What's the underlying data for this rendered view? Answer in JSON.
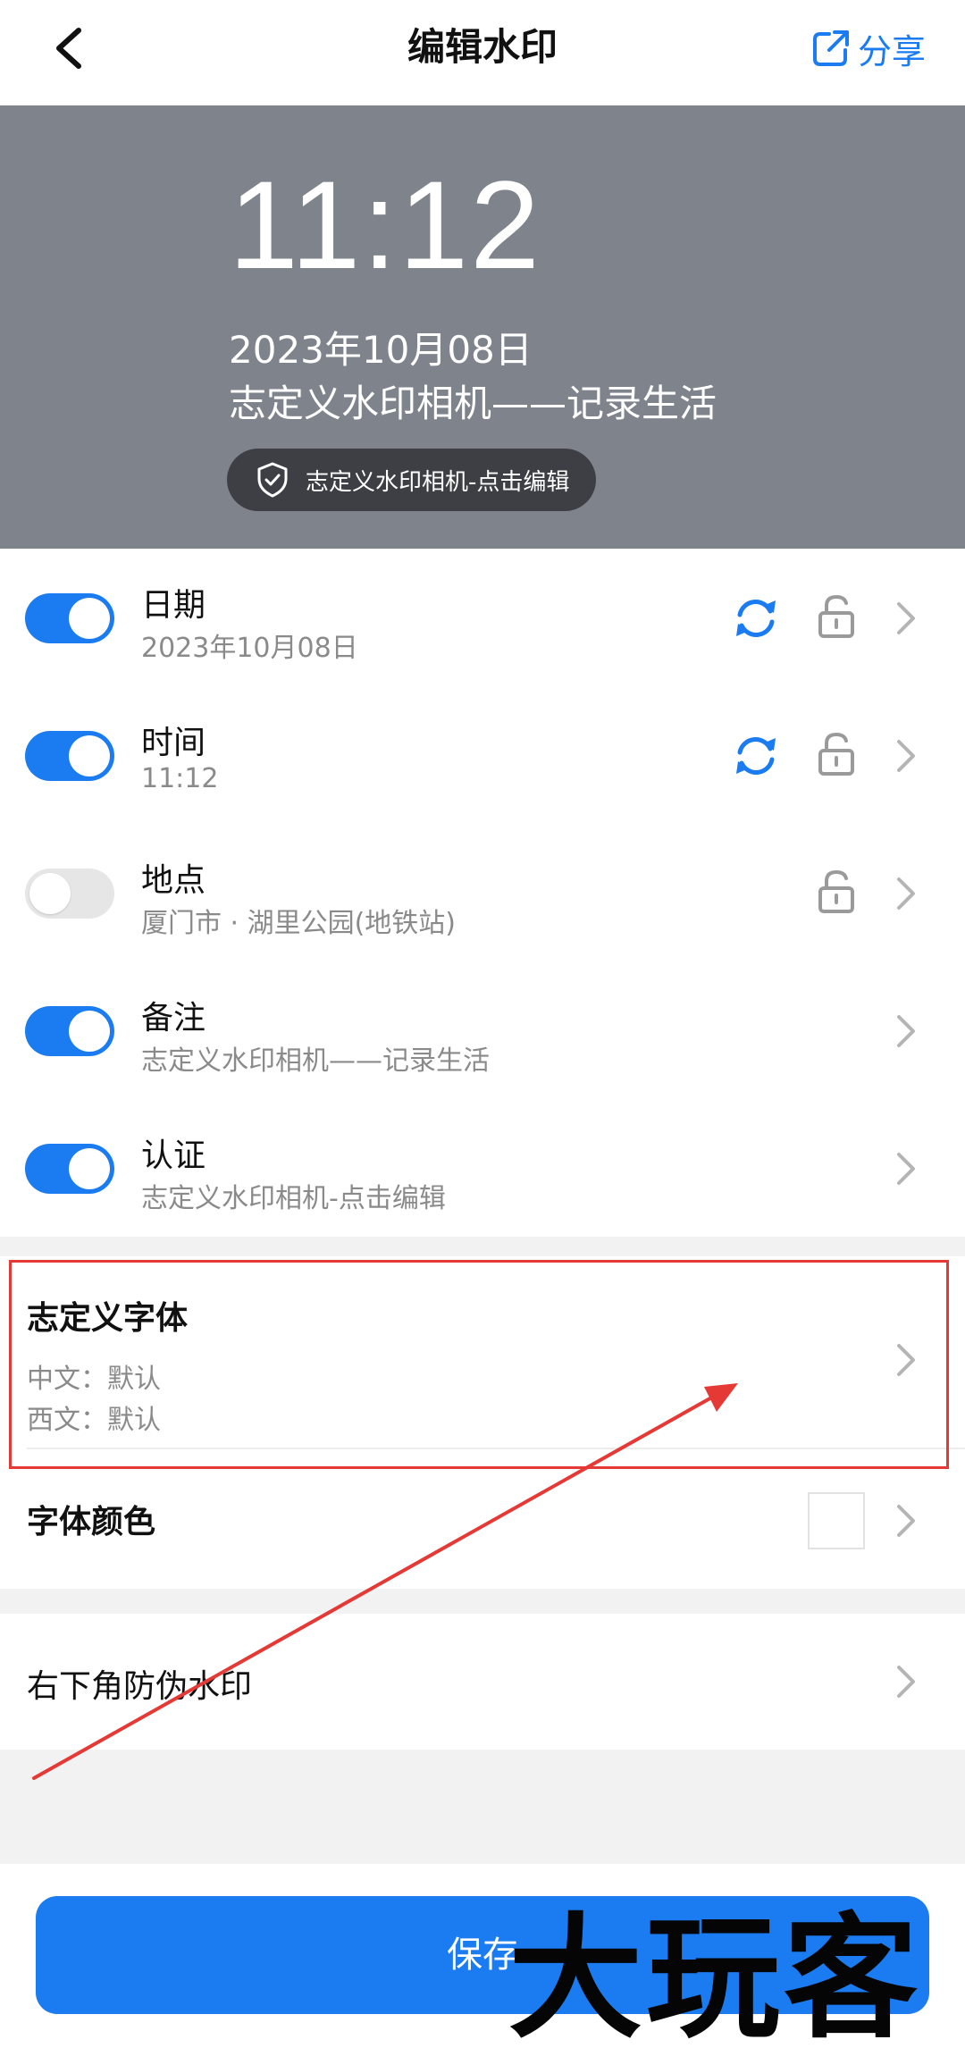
{
  "header": {
    "title": "编辑水印",
    "share_label": "分享"
  },
  "preview": {
    "time": "11:12",
    "date": "2023年10月08日",
    "note": "志定义水印相机——记录生活",
    "badge": "志定义水印相机-点击编辑"
  },
  "items": [
    {
      "label": "日期",
      "value": "2023年10月08日",
      "enabled": true
    },
    {
      "label": "时间",
      "value": "11:12",
      "enabled": true
    },
    {
      "label": "地点",
      "value": "厦门市 · 湖里公园(地铁站)",
      "enabled": false
    },
    {
      "label": "备注",
      "value": "志定义水印相机——记录生活",
      "enabled": true
    },
    {
      "label": "认证",
      "value": "志定义水印相机-点击编辑",
      "enabled": true
    }
  ],
  "font": {
    "title": "志定义字体",
    "chinese": "中文：默认",
    "western": "西文：默认"
  },
  "font_color": {
    "title": "字体颜色",
    "swatch": "#ffffff"
  },
  "anti_fake": {
    "title": "右下角防伪水印"
  },
  "save_label": "保存",
  "watermark_text": "大玩客",
  "colors": {
    "accent": "#1a7cf0",
    "preview_bg": "#7e838c",
    "annotation": "#e53935"
  }
}
